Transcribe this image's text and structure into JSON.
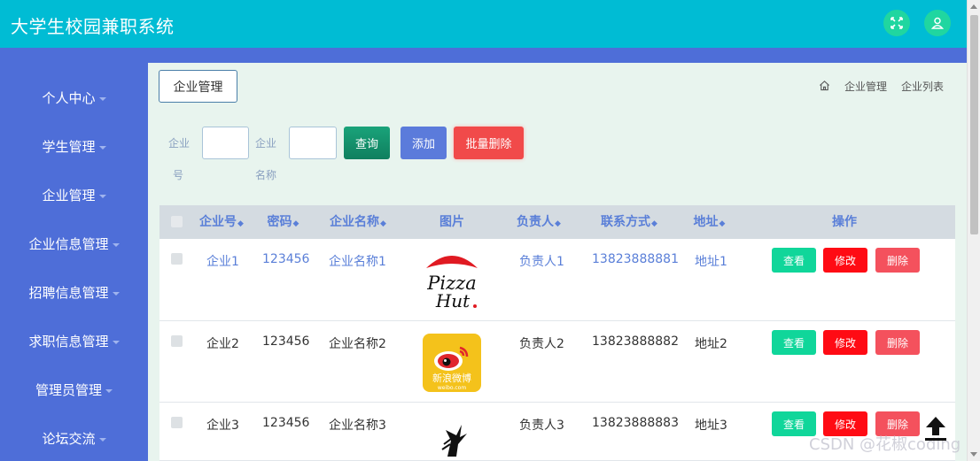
{
  "app": {
    "title": "大学生校园兼职系统"
  },
  "header": {
    "fullscreen_icon": "fullscreen-icon",
    "user_icon": "user-icon",
    "accent": "#00bcd4"
  },
  "sidebar": {
    "items": [
      {
        "label": "个人中心"
      },
      {
        "label": "学生管理"
      },
      {
        "label": "企业管理"
      },
      {
        "label": "企业信息管理"
      },
      {
        "label": "招聘信息管理"
      },
      {
        "label": "求职信息管理"
      },
      {
        "label": "管理员管理"
      },
      {
        "label": "论坛交流"
      }
    ]
  },
  "page": {
    "title": "企业管理",
    "breadcrumb": {
      "home_icon": "home-icon",
      "items": [
        "企业管理",
        "企业列表"
      ]
    }
  },
  "filters": {
    "company_no": {
      "label_line1": "企业",
      "label_line2": "号",
      "value": ""
    },
    "company_name": {
      "label_line1": "企业",
      "label_line2": "名称",
      "value": ""
    }
  },
  "actions": {
    "query": "查询",
    "add": "添加",
    "batch_delete": "批量删除"
  },
  "table": {
    "columns": [
      "企业号",
      "密码",
      "企业名称",
      "图片",
      "负责人",
      "联系方式",
      "地址",
      "操作"
    ],
    "rows": [
      {
        "no": "企业1",
        "password": "123456",
        "name": "企业名称1",
        "image": "Pizza Hut logo",
        "contact_person": "负责人1",
        "phone": "13823888881",
        "address": "地址1"
      },
      {
        "no": "企业2",
        "password": "123456",
        "name": "企业名称2",
        "image": "新浪微博 weibo.com logo",
        "contact_person": "负责人2",
        "phone": "13823888882",
        "address": "地址2"
      },
      {
        "no": "企业3",
        "password": "123456",
        "name": "企业名称3",
        "image": "black bird logo",
        "contact_person": "负责人3",
        "phone": "13823888883",
        "address": "地址3"
      }
    ],
    "row_actions": {
      "view": "查看",
      "edit": "修改",
      "delete": "删除"
    }
  },
  "overlay": {
    "watermark": "CSDN @花椒coding",
    "back_to_top_icon": "arrow-up-icon"
  }
}
